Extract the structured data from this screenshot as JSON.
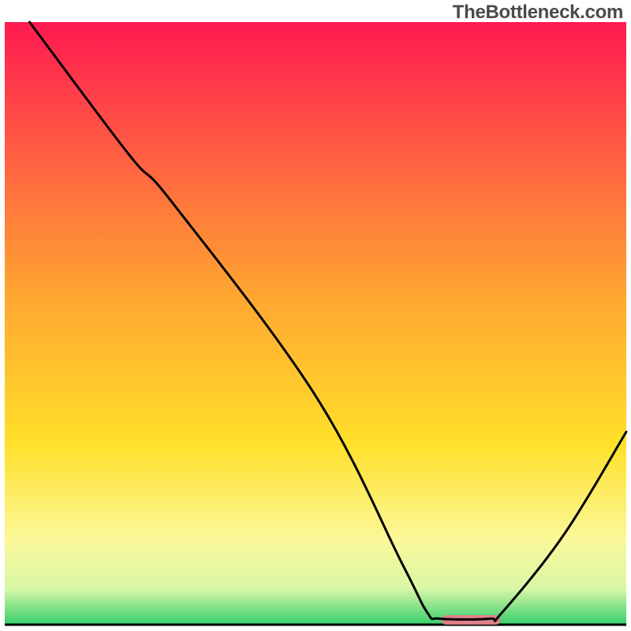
{
  "watermark": "TheBottleneck.com",
  "chart_data": {
    "type": "line",
    "title": "",
    "xlabel": "",
    "ylabel": "",
    "xlim": [
      0,
      100
    ],
    "ylim": [
      0,
      100
    ],
    "background_gradient": {
      "stops": [
        {
          "offset": 0,
          "color": "#ff1a51"
        },
        {
          "offset": 45,
          "color": "#ffa531"
        },
        {
          "offset": 70,
          "color": "#ffe02a"
        },
        {
          "offset": 86,
          "color": "#fbf89a"
        },
        {
          "offset": 94,
          "color": "#d9f7a6"
        },
        {
          "offset": 100,
          "color": "#35cf6d"
        }
      ]
    },
    "series": [
      {
        "name": "curve",
        "color": "#000000",
        "stroke_width": 3,
        "points": [
          {
            "x": 4,
            "y": 100
          },
          {
            "x": 20,
            "y": 78
          },
          {
            "x": 27,
            "y": 70
          },
          {
            "x": 50,
            "y": 38
          },
          {
            "x": 64,
            "y": 10
          },
          {
            "x": 68,
            "y": 2
          },
          {
            "x": 70,
            "y": 1
          },
          {
            "x": 78,
            "y": 1
          },
          {
            "x": 80,
            "y": 2
          },
          {
            "x": 90,
            "y": 15
          },
          {
            "x": 100,
            "y": 32
          }
        ]
      }
    ],
    "marker": {
      "name": "highlight-segment",
      "x_start": 71,
      "x_end": 79,
      "y": 0.8,
      "color": "#e08088",
      "thickness": 12
    }
  }
}
